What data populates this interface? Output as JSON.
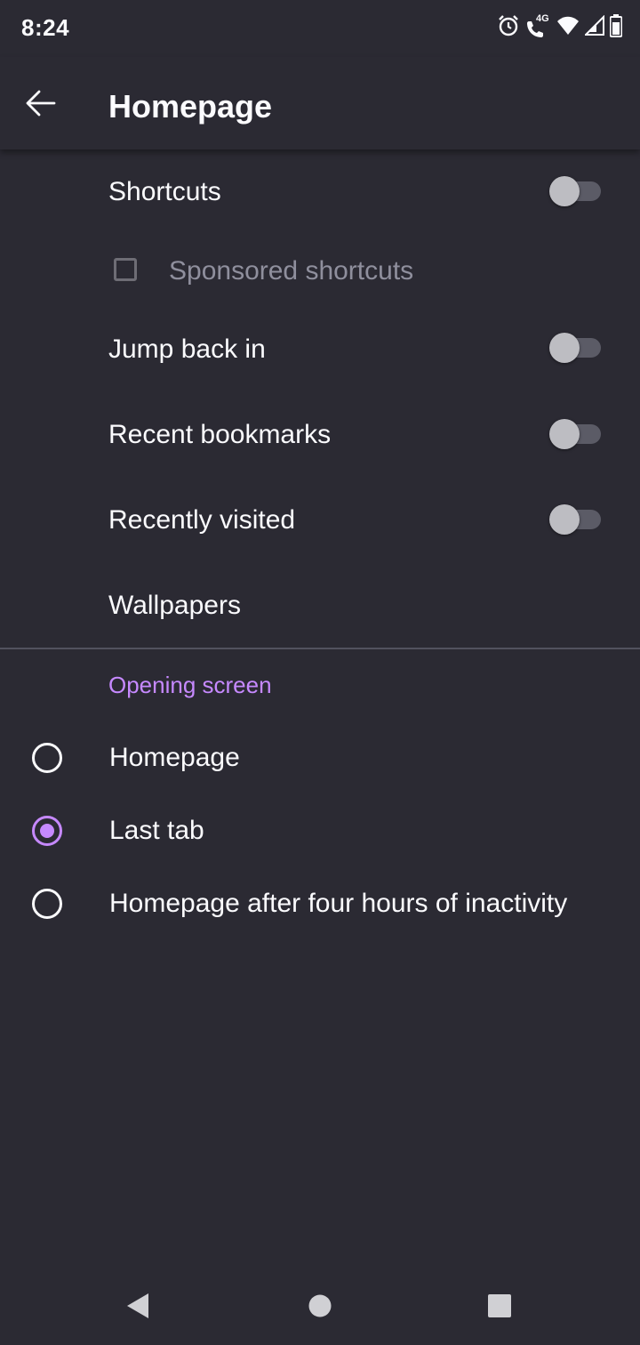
{
  "status_bar": {
    "time": "8:24",
    "network": "4G",
    "icons": [
      "alarm-icon",
      "volte-call-icon",
      "wifi-icon",
      "signal-icon",
      "battery-icon"
    ]
  },
  "app_bar": {
    "title": "Homepage",
    "back_icon": "arrow-left-icon"
  },
  "settings": {
    "shortcuts": {
      "label": "Shortcuts",
      "enabled": false
    },
    "sponsored_shortcuts": {
      "label": "Sponsored shortcuts",
      "checked": false,
      "disabled": true
    },
    "jump_back_in": {
      "label": "Jump back in",
      "enabled": false
    },
    "recent_bookmarks": {
      "label": "Recent bookmarks",
      "enabled": false
    },
    "recently_visited": {
      "label": "Recently visited",
      "enabled": false
    },
    "wallpapers": {
      "label": "Wallpapers"
    }
  },
  "opening_screen": {
    "title": "Opening screen",
    "options": [
      {
        "label": "Homepage",
        "selected": false
      },
      {
        "label": "Last tab",
        "selected": true
      },
      {
        "label": "Homepage after four hours of inactivity",
        "selected": false
      }
    ]
  },
  "colors": {
    "background": "#2b2a33",
    "accent": "#c689ff",
    "text": "#fbfbfe",
    "disabled_text": "#8f8f9d"
  },
  "nav_bar": {
    "icons": [
      "nav-back-icon",
      "nav-home-icon",
      "nav-recents-icon"
    ]
  }
}
